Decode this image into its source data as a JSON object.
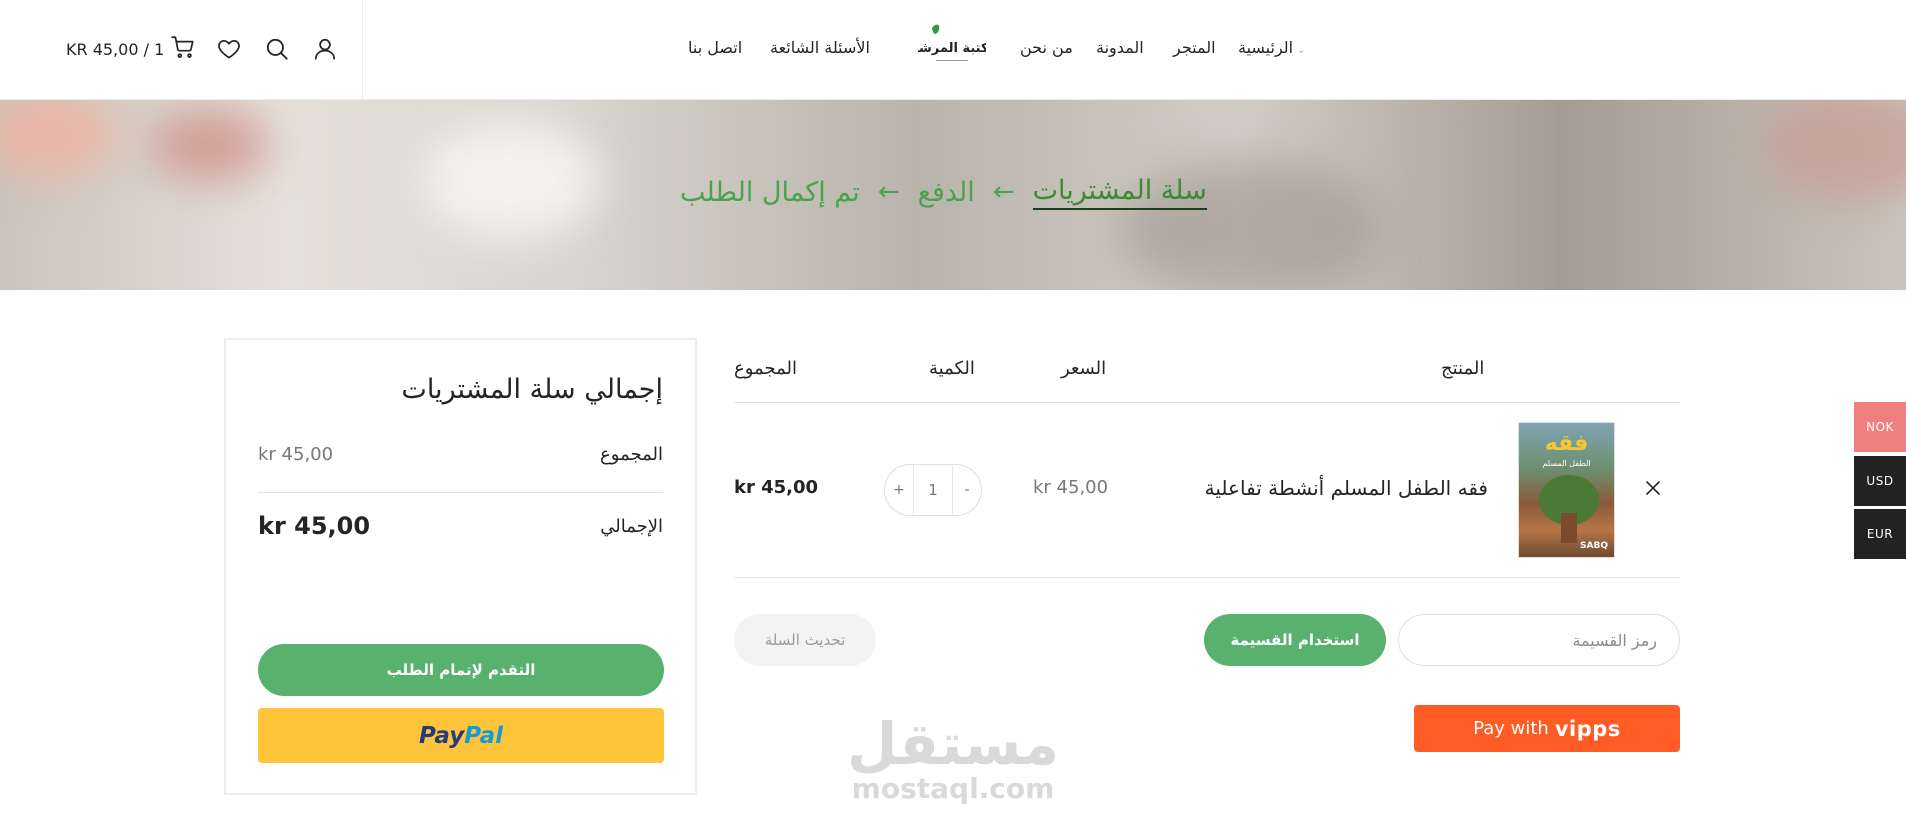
{
  "header": {
    "cart_text": "KR 45,00 / 1",
    "nav": {
      "home": "الرئيسية",
      "shop": "المتجر",
      "blog": "المدونة",
      "about": "من نحن",
      "faq": "الأسئلة الشائعة",
      "contact": "اتصل بنا"
    },
    "logo_text": "مكتبة المرشاد"
  },
  "breadcrumb": {
    "step1": "سلة المشتريات",
    "step2": "الدفع",
    "step3": "تم إكمال الطلب",
    "separator": "←"
  },
  "currency_switcher": [
    "NOK",
    "USD",
    "EUR"
  ],
  "cart": {
    "headers": {
      "product": "المنتج",
      "price": "السعر",
      "quantity": "الكمية",
      "subtotal": "المجموع"
    },
    "items": [
      {
        "name": "فقه الطفل المسلم أنشطة تفاعلية",
        "price": "kr 45,00",
        "quantity": "1",
        "subtotal": "kr 45,00",
        "thumb_title": "فقه",
        "thumb_subtitle": "الطفل المسلم",
        "thumb_brand": "SABQ"
      }
    ],
    "qty_minus": "-",
    "qty_plus": "+",
    "coupon_placeholder": "رمز القسيمة",
    "apply_coupon": "استخدام القسيمة",
    "update_cart": "تحديث السلة",
    "vipps_label": "Pay with",
    "vipps_brand": "vipps"
  },
  "totals": {
    "title": "إجمالي سلة المشتريات",
    "subtotal_label": "المجموع",
    "subtotal_value": "kr 45,00",
    "total_label": "الإجمالي",
    "total_value": "kr 45,00",
    "checkout": "التقدم لإتمام الطلب",
    "paypal_a": "Pay",
    "paypal_b": "Pal"
  },
  "watermark": {
    "arabic": "مستقل",
    "latin": "mostaql.com"
  },
  "colors": {
    "accent_green": "#58b26e",
    "breadcrumb_green": "#4aa24a",
    "vipps_orange": "#ff5b24",
    "paypal_yellow": "#ffc439",
    "nok_tab": "#f08080",
    "dark_tab": "#222222"
  }
}
